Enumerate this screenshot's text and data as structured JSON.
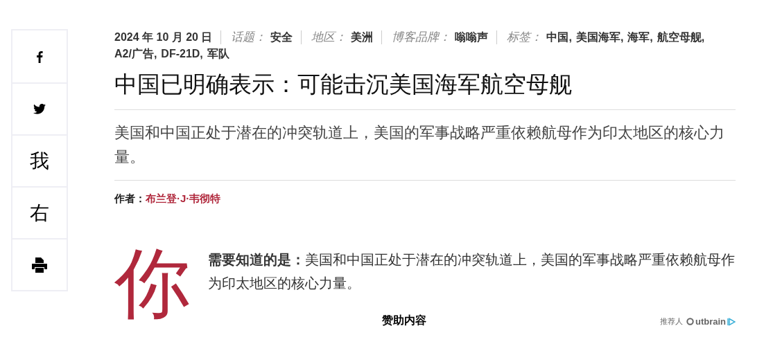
{
  "share_bar": [
    {
      "kind": "facebook"
    },
    {
      "kind": "twitter"
    },
    {
      "kind": "text",
      "label": "我"
    },
    {
      "kind": "text",
      "label": "右"
    },
    {
      "kind": "print"
    }
  ],
  "meta": {
    "date": "2024 年 10 月 20 日",
    "fields": [
      {
        "label": "话题：",
        "values": [
          "安全"
        ]
      },
      {
        "label": "地区：",
        "values": [
          "美洲"
        ]
      },
      {
        "label": "博客品牌：",
        "values": [
          "嗡嗡声"
        ]
      },
      {
        "label": "标签：",
        "values": [
          "中国,",
          "美国海军,",
          "海军,",
          "航空母舰,",
          "A2/广告,",
          "DF-21D,",
          "军队"
        ]
      }
    ]
  },
  "title": "中国已明确表示：可能击沉美国海军航空母舰",
  "summary": "美国和中国正处于潜在的冲突轨道上，美国的军事战略严重依赖航母作为印太地区的核心力量。",
  "byline": {
    "label": "作者：",
    "author": "布兰登·J·韦彻特"
  },
  "drop_cap": "你",
  "body": "**需要知道的是：**美国和中国正处于潜在的冲突轨道上，美国的军事战略严重依赖航母作为印太地区的核心力量。",
  "footer": {
    "sponsored": "赞助内容",
    "recommended_by": "推荐人",
    "brand": "utbrain"
  }
}
